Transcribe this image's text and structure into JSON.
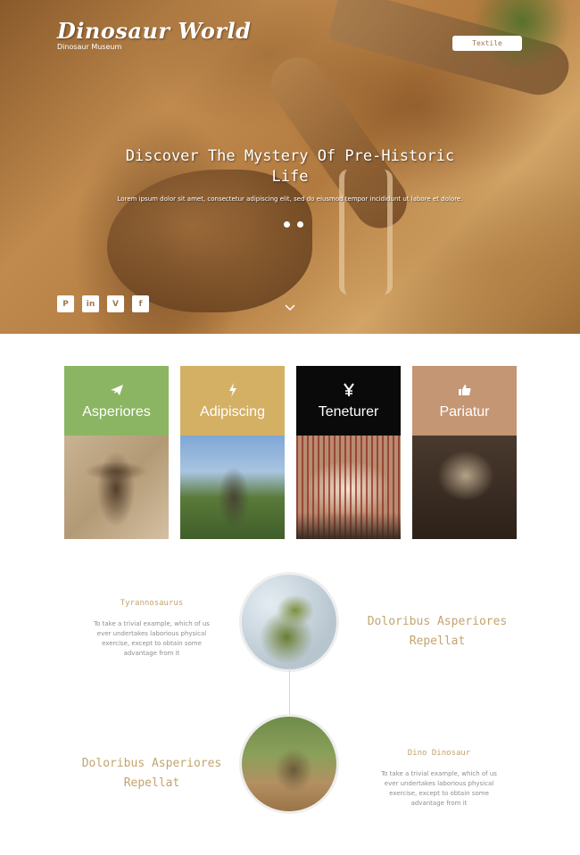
{
  "header": {
    "brand_title": "Dinosaur World",
    "brand_subtitle": "Dinosaur Museum",
    "cta_label": "Textile"
  },
  "hero": {
    "heading": "Discover The Mystery Of Pre-Historic Life",
    "description": "Lorem ipsum dolor sit amet, consectetur adipiscing elit, sed do eiusmod tempor incididunt ut labore et dolore.",
    "slides": {
      "count": 2,
      "active": 1
    },
    "socials": [
      {
        "icon": "pinterest-icon",
        "glyph": "P"
      },
      {
        "icon": "linkedin-icon",
        "glyph": "in"
      },
      {
        "icon": "vimeo-icon",
        "glyph": "V"
      },
      {
        "icon": "facebook-icon",
        "glyph": "f"
      }
    ]
  },
  "features": [
    {
      "label": "Asperiores",
      "icon": "paper-plane-icon",
      "color": "#8bb562"
    },
    {
      "label": "Adipiscing",
      "icon": "lightning-icon",
      "color": "#d4b065"
    },
    {
      "label": "Teneturer",
      "icon": "yen-icon",
      "color": "#0a0a0a"
    },
    {
      "label": "Pariatur",
      "icon": "thumbs-up-icon",
      "color": "#c49673"
    }
  ],
  "timeline": [
    {
      "title": "Tyrannosaurus",
      "description": "To take a trivial example, which of us ever undertakes laborious physical exercise, except to obtain some advantage from it",
      "side_title": "Doloribus Asperiores Repellat"
    },
    {
      "title": "Dino Dinosaur",
      "description": "To take a trivial example, which of us ever undertakes laborious physical exercise, except to obtain some advantage from it",
      "side_title": "Doloribus Asperiores Repellat"
    }
  ],
  "colors": {
    "accent_gold": "#c3a46d",
    "text_gray": "#8e8e8e"
  }
}
